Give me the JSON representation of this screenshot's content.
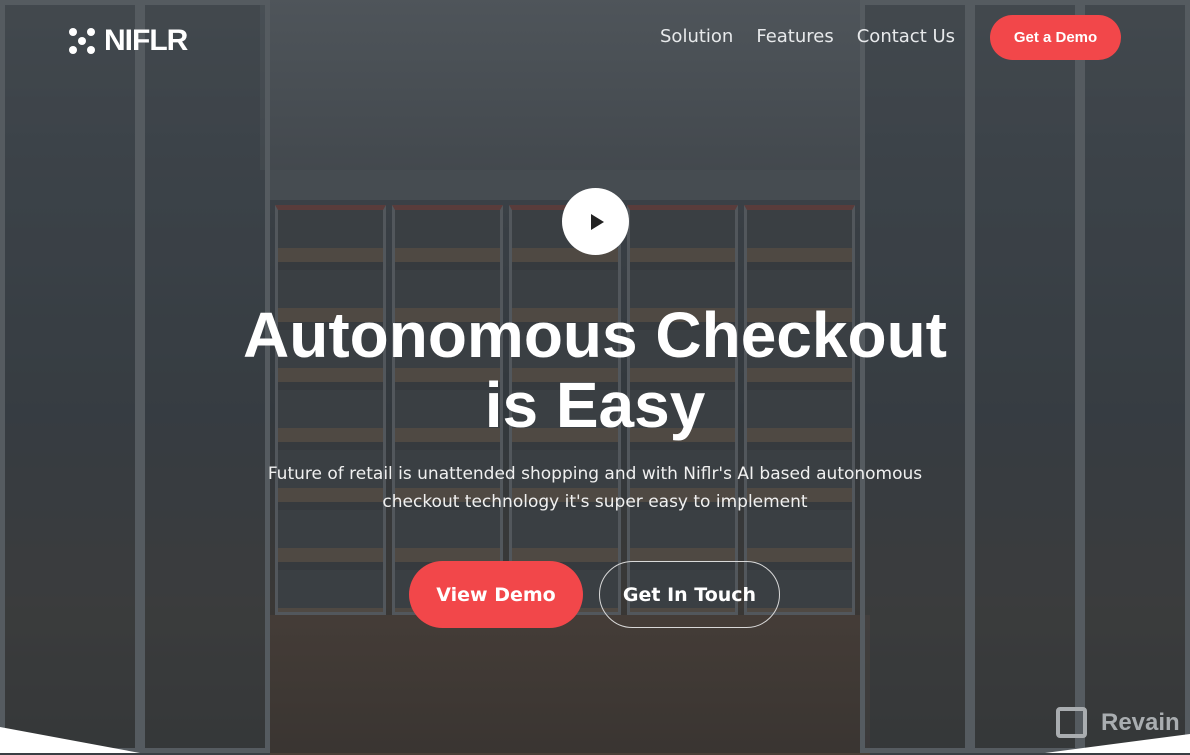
{
  "nav": {
    "logo": "NIFLR",
    "links": [
      "Solution",
      "Features",
      "Contact Us"
    ],
    "cta": "Get a Demo"
  },
  "hero": {
    "title_line1": "Autonomous Checkout",
    "title_line2": "is Easy",
    "subtitle_line1": "Future of retail is unattended shopping and with Niflr's AI based autonomous",
    "subtitle_line2": "checkout technology it's super easy to implement",
    "primary_button": "View Demo",
    "secondary_button": "Get In Touch"
  },
  "watermark": "Revain",
  "colors": {
    "accent": "#f2474a"
  }
}
